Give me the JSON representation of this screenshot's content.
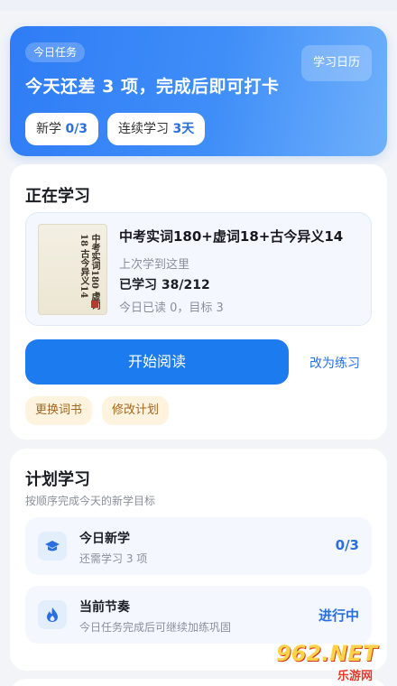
{
  "hero": {
    "tag": "今日任务",
    "title": "今天还差 3 项，完成后即可打卡",
    "calendar_button": "学习日历",
    "new_label": "新学",
    "new_value": "0/3",
    "streak_label": "连续学习",
    "streak_value": "3天"
  },
  "study": {
    "title": "正在学习",
    "book": {
      "name": "中考实词180+虚词18+古今异义14",
      "last_position": "上次学到这里",
      "learned": "已学习 38/212",
      "today": "今日已读 0，目标 3",
      "cover_text": "中考实词180 虚词18 古今异义14"
    },
    "read_button": "开始阅读",
    "practice_link": "改为练习",
    "change_book": "更换词书",
    "edit_plan": "修改计划"
  },
  "plan": {
    "title": "计划学习",
    "subtitle": "按顺序完成今天的新学目标",
    "rows": [
      {
        "title": "今日新学",
        "desc": "还需学习 3 项",
        "value": "0/3",
        "icon": "graduation-cap-icon"
      },
      {
        "title": "当前节奏",
        "desc": "今日任务完成后可继续加练巩固",
        "value": "进行中",
        "icon": "flame-icon"
      }
    ]
  },
  "watermark": {
    "main": "962.NET",
    "sub": "乐游网"
  },
  "colors": {
    "accent": "#1d7bf0",
    "pill_bg": "#fdf3df",
    "pill_text": "#a5661b"
  }
}
